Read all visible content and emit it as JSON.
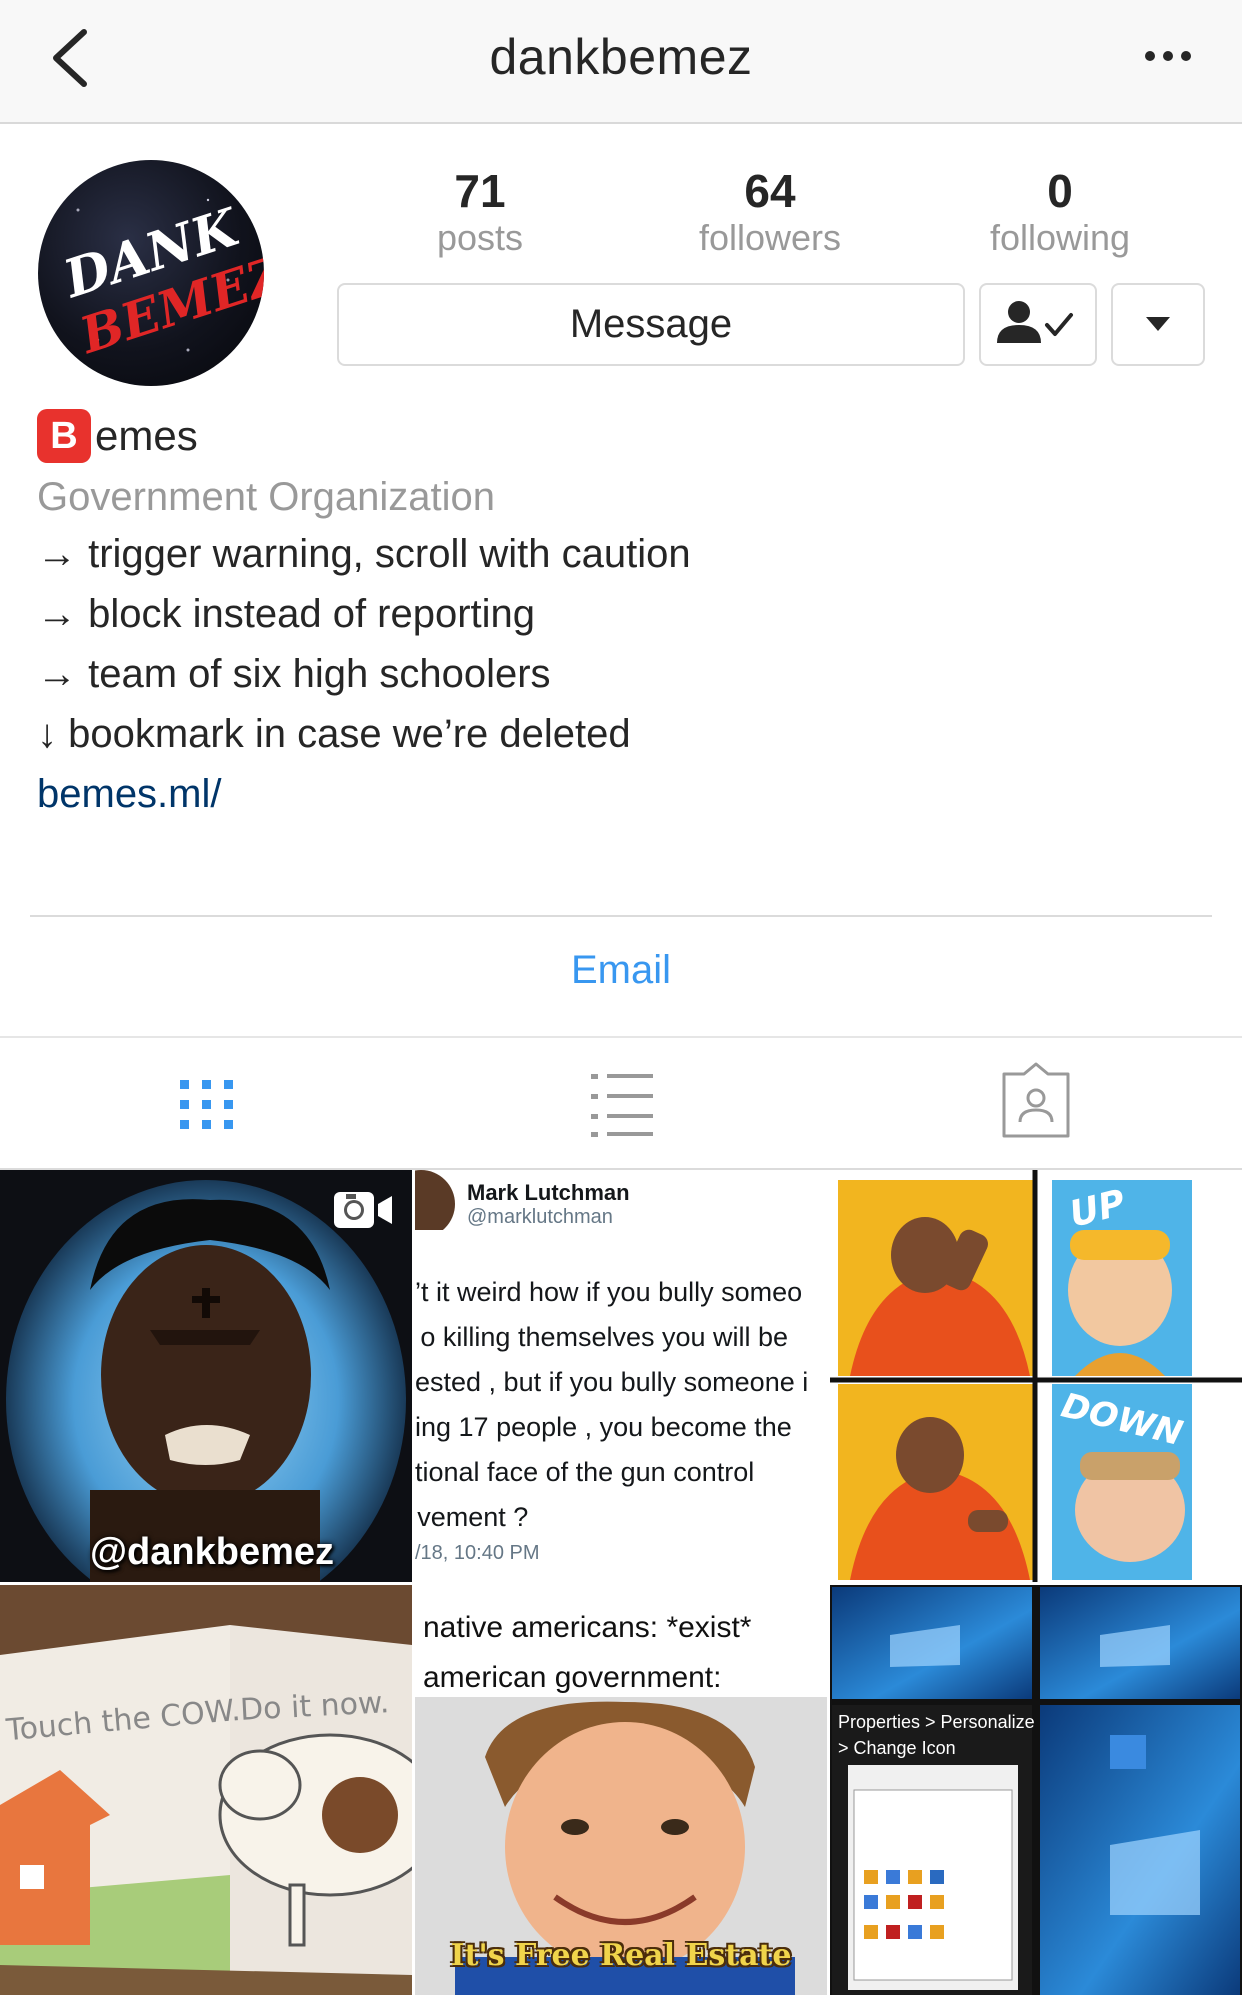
{
  "nav": {
    "title": "dankbemez",
    "back_icon": "chevron-left-icon",
    "more_icon": "more-horizontal-icon"
  },
  "profile": {
    "avatar_text_1": "DANK",
    "avatar_text_2": "BEMEZ",
    "stats": {
      "posts": {
        "count": "71",
        "label": "posts"
      },
      "followers": {
        "count": "64",
        "label": "followers"
      },
      "following": {
        "count": "0",
        "label": "following"
      }
    },
    "buttons": {
      "message": "Message",
      "following_icon": "person-check-icon",
      "dropdown_icon": "caret-down-icon"
    }
  },
  "bio": {
    "emoji_letter": "B",
    "name_rest": "emes",
    "category": "Government Organization",
    "lines": [
      "→ trigger warning, scroll with caution",
      "→ block instead of reporting",
      "→ team of six high schoolers",
      "↓ bookmark in case we’re deleted"
    ],
    "link": "bemes.ml/"
  },
  "contact": {
    "email_label": "Email"
  },
  "tabs": [
    {
      "name": "grid",
      "icon": "grid-icon",
      "active": true
    },
    {
      "name": "list",
      "icon": "list-icon",
      "active": false
    },
    {
      "name": "tagged",
      "icon": "tagged-icon",
      "active": false
    }
  ],
  "posts": {
    "p1": {
      "watermark": "@dankbemez",
      "icon": "video-icon"
    },
    "p2": {
      "author": "Mark Lutchman",
      "handle": "@marklutchman",
      "body": "’t it weird how if you bully someo\n o killing themselves you will be\nested , but if you bully someone i\ning 17 people , you become the\ntional face of the gun control\n vement ?",
      "time": "/18, 10:40 PM"
    },
    "p3": {
      "top_right_label": "UP",
      "bottom_right_label": "DOWN"
    },
    "p4": {
      "text_left": "Touch the COW.",
      "text_right": "Do it now."
    },
    "p5": {
      "text": "native americans: *exist*\namerican government:",
      "caption": "It's Free Real Estate"
    },
    "p6": {
      "props_text": "Properties > Personalize\n> Change Icon"
    }
  },
  "colors": {
    "link_blue": "#3897f0",
    "bio_link": "#003569",
    "gray_text": "#999999",
    "border": "#dbdbdb",
    "emoji_red": "#e8322d"
  }
}
